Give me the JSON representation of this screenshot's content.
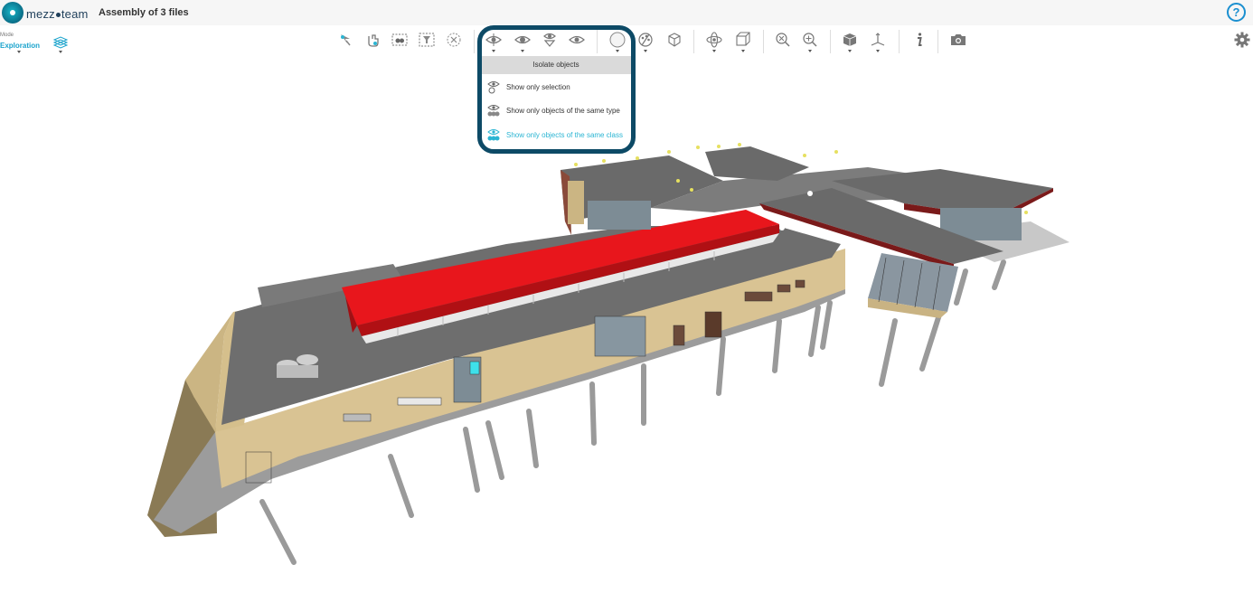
{
  "header": {
    "brand_pre": "mezz",
    "brand_post": "team",
    "title": "Assembly of 3 files",
    "help_label": "?"
  },
  "mode": {
    "label": "Mode",
    "value": "Exploration"
  },
  "toolbar": {
    "icons": [
      "select-arrow-icon",
      "select-hand-icon",
      "select-box-icon",
      "filter-icon",
      "clear-selection-icon",
      "hide-icon",
      "show-icon",
      "isolate-icon",
      "eye-icon",
      "transparency-icon",
      "paint-icon",
      "section-box-icon",
      "orbit-icon",
      "fit-box-icon",
      "zoom-out-icon",
      "zoom-in-icon",
      "view-cube-icon",
      "axis-icon",
      "info-icon",
      "camera-icon",
      "settings-gear-icon"
    ]
  },
  "isolate_menu": {
    "title": "Isolate objects",
    "items": [
      {
        "label": "Show only selection",
        "active": false
      },
      {
        "label": "Show only objects of the same type",
        "active": false
      },
      {
        "label": "Show only objects of the same class",
        "active": true
      }
    ]
  },
  "colors": {
    "brand": "#0a6c86",
    "accent": "#2bb5d3",
    "highlight_border": "#0d4a66",
    "selection": "#e8161c"
  }
}
